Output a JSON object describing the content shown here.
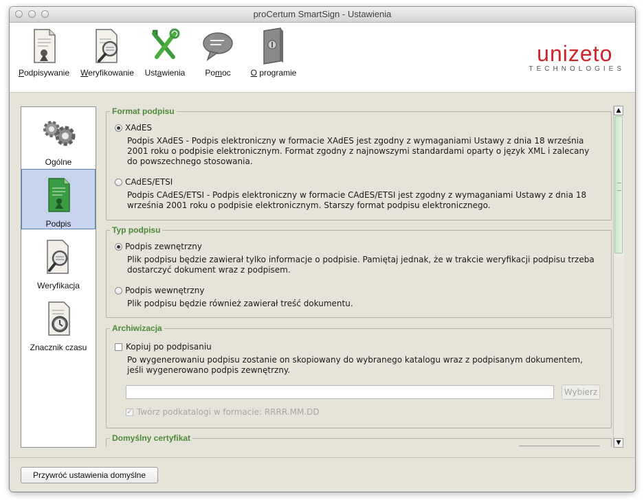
{
  "window": {
    "title": "proCertum SmartSign - Ustawienia"
  },
  "toolbar": {
    "items": [
      {
        "label_u": "P",
        "label_rest": "odpisywanie",
        "icon": "sign-document-icon"
      },
      {
        "label_u": "W",
        "label_rest": "eryfikowanie",
        "icon": "verify-document-icon"
      },
      {
        "label_pre": "Ust",
        "label_u": "a",
        "label_rest": "wienia",
        "icon": "tools-icon"
      },
      {
        "label_pre": "Po",
        "label_u": "m",
        "label_rest": "oc",
        "icon": "help-bubble-icon"
      },
      {
        "label_u": "O",
        "label_rest": " programie",
        "icon": "about-icon"
      }
    ],
    "logo": {
      "main": "unizeto",
      "sub": "TECHNOLOGIES",
      "color": "#d1232a"
    }
  },
  "sidebar": {
    "items": [
      {
        "label": "Ogólne",
        "icon": "gears-icon",
        "selected": false
      },
      {
        "label": "Podpis",
        "icon": "signed-document-icon",
        "selected": true
      },
      {
        "label": "Weryfikacja",
        "icon": "verify-document-icon",
        "selected": false
      },
      {
        "label": "Znacznik czasu",
        "icon": "timestamp-clock-icon",
        "selected": false
      }
    ]
  },
  "format": {
    "legend": "Format podpisu",
    "opt1": {
      "label": "XAdES",
      "checked": true,
      "desc": "Podpis XAdES - Podpis elektroniczny w formacie XAdES jest zgodny z wymaganiami Ustawy z dnia 18 września 2001 roku o podpisie elektronicznym. Format zgodny z najnowszymi standardami oparty o język XML i zalecany do powszechnego stosowania."
    },
    "opt2": {
      "label": "CAdES/ETSI",
      "checked": false,
      "desc": "Podpis CAdES/ETSI - Podpis elektroniczny w formacie CAdES/ETSI jest zgodny z wymaganiami Ustawy z dnia 18 września 2001 roku o podpisie elektronicznym. Starszy format podpisu elektronicznego."
    }
  },
  "type": {
    "legend": "Typ podpisu",
    "opt1": {
      "label": "Podpis zewnętrzny",
      "checked": true,
      "desc": "Plik podpisu będzie zawierał tylko informacje o podpisie. Pamiętaj jednak, że w trakcie weryfikacji podpisu trzeba dostarczyć dokument wraz z podpisem."
    },
    "opt2": {
      "label": "Podpis wewnętrzny",
      "checked": false,
      "desc": "Plik podpisu będzie również zawierał treść dokumentu."
    }
  },
  "archive": {
    "legend": "Archiwizacja",
    "copy_label": "Kopiuj po podpisaniu",
    "desc": "Po wygenerowaniu podpisu zostanie on skopiowany do wybranego katalogu wraz z podpisanym dokumentem, jeśli wygenerowano podpis zewnętrzny.",
    "path_value": "",
    "choose_label": "Wybierz",
    "subdir_label": "Twórz podkatalogi w formacie: RRRR.MM.DD"
  },
  "cert": {
    "legend": "Domyślny certyfikat"
  },
  "footer": {
    "reset_label": "Przywróć ustawienia domyślne"
  }
}
